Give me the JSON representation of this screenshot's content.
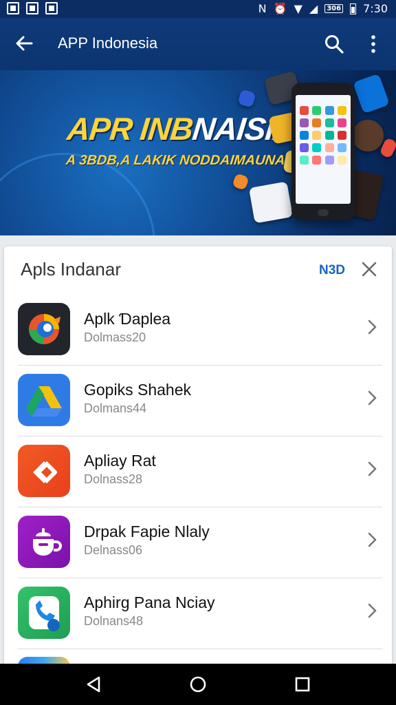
{
  "status_bar": {
    "time": "7:30",
    "badge": "306"
  },
  "app_bar": {
    "title": "APP Indonesia"
  },
  "banner": {
    "headline_part1": "APR INB",
    "headline_part2": "NAISIA",
    "subheadline": "A 3BDB,A LAKIK NODDAIMAUNA"
  },
  "sheet": {
    "title": "Apls Indanar",
    "action_label": "N3D"
  },
  "apps": [
    {
      "name": "Aplk Ɗaplea",
      "subtitle": "Dolmass20",
      "icon": "browser-swirl-icon"
    },
    {
      "name": "Gopiks Shahek",
      "subtitle": "Dolmans44",
      "icon": "drive-triangle-icon"
    },
    {
      "name": "Apliay Rat",
      "subtitle": "Dolnass28",
      "icon": "orange-arrow-icon"
    },
    {
      "name": "Drpak Fapie Nlaly",
      "subtitle": "Delnass06",
      "icon": "coffee-cup-icon"
    },
    {
      "name": "Aphirg Pana Nciay",
      "subtitle": "Dolnans48",
      "icon": "phone-chat-icon"
    }
  ],
  "colors": {
    "app_bar": "#0e3a7a",
    "accent": "#1565c0",
    "banner_yellow": "#ffd43b"
  }
}
